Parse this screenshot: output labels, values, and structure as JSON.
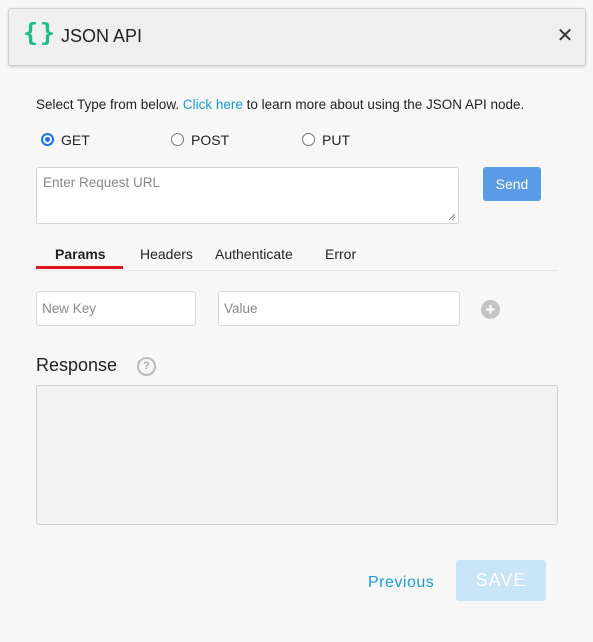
{
  "header": {
    "icon": "curly-braces-icon",
    "icon_glyph": "{}",
    "title": "JSON API",
    "close_glyph": "✕"
  },
  "intro": {
    "before": "Select Type from below. ",
    "link": "Click here",
    "after": " to learn more about using the JSON API node."
  },
  "request_type": {
    "options": [
      "GET",
      "POST",
      "PUT"
    ],
    "selected": "GET"
  },
  "url": {
    "placeholder": "Enter Request URL",
    "value": ""
  },
  "send_label": "Send",
  "tabs": {
    "items": [
      "Params",
      "Headers",
      "Authenticate",
      "Error"
    ],
    "active": "Params"
  },
  "params": {
    "key_placeholder": "New Key",
    "value_placeholder": "Value",
    "add_glyph": "+"
  },
  "response": {
    "title": "Response",
    "help_glyph": "?",
    "body": ""
  },
  "footer": {
    "previous_label": "Previous",
    "save_label": "SAVE"
  },
  "colors": {
    "accent_icon": "#1abc8a",
    "link": "#1a9bd7",
    "send_button": "#5a9be8",
    "active_tab_underline": "#e0141e",
    "save_button_disabled": "#c8e4f8"
  }
}
